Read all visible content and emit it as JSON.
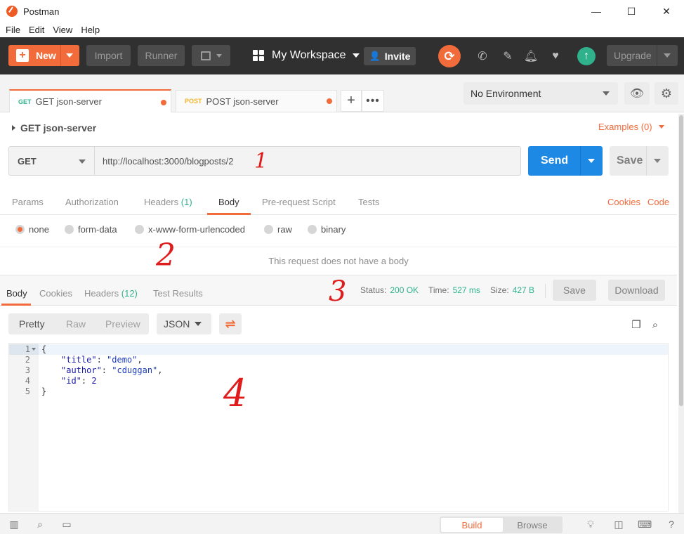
{
  "window": {
    "title": "Postman",
    "controls": [
      "—",
      "☐",
      "✕"
    ]
  },
  "menu": [
    "File",
    "Edit",
    "View",
    "Help"
  ],
  "toolbar": {
    "new_label": "New",
    "import_label": "Import",
    "runner_label": "Runner",
    "workspace_label": "My Workspace",
    "invite_label": "Invite",
    "upgrade_label": "Upgrade"
  },
  "tabs": [
    {
      "method": "GET",
      "label": "GET json-server",
      "active": true
    },
    {
      "method": "POST",
      "label": "POST json-server",
      "active": false
    }
  ],
  "environment": {
    "selected": "No Environment"
  },
  "request": {
    "name": "GET json-server",
    "examples_label": "Examples (0)",
    "method": "GET",
    "url": "http://localhost:3000/blogposts/2",
    "send_label": "Send",
    "save_label": "Save"
  },
  "request_tabs": {
    "params": "Params",
    "authorization": "Authorization",
    "headers": "Headers",
    "headers_count": "(1)",
    "body": "Body",
    "prerequest": "Pre-request Script",
    "tests": "Tests",
    "cookies": "Cookies",
    "code": "Code"
  },
  "body_options": {
    "none": "none",
    "form_data": "form-data",
    "urlencoded": "x-www-form-urlencoded",
    "raw": "raw",
    "binary": "binary",
    "selected": "none"
  },
  "no_body_message": "This request does not have a body",
  "response": {
    "tabs": {
      "body": "Body",
      "cookies": "Cookies",
      "headers": "Headers",
      "headers_count": "(12)",
      "test_results": "Test Results"
    },
    "status_label": "Status:",
    "status": "200 OK",
    "time_label": "Time:",
    "time": "527 ms",
    "size_label": "Size:",
    "size": "427 B",
    "save_label": "Save",
    "download_label": "Download"
  },
  "viewer": {
    "pretty": "Pretty",
    "raw": "Raw",
    "preview": "Preview",
    "format": "JSON"
  },
  "code_lines": [
    {
      "n": "1",
      "text": "{"
    },
    {
      "n": "2",
      "key": "\"title\"",
      "val": "\"demo\"",
      "trail": ","
    },
    {
      "n": "3",
      "key": "\"author\"",
      "val": "\"cduggan\"",
      "trail": ","
    },
    {
      "n": "4",
      "key": "\"id\"",
      "val": "2",
      "trail": ""
    },
    {
      "n": "5",
      "text": "}"
    }
  ],
  "statusbar": {
    "build": "Build",
    "browse": "Browse"
  },
  "annotations": [
    "1",
    "2",
    "3",
    "4"
  ],
  "colors": {
    "accent": "#f26b3a",
    "send": "#1e88e5",
    "success": "#2fb28c",
    "toolbar": "#303030"
  }
}
